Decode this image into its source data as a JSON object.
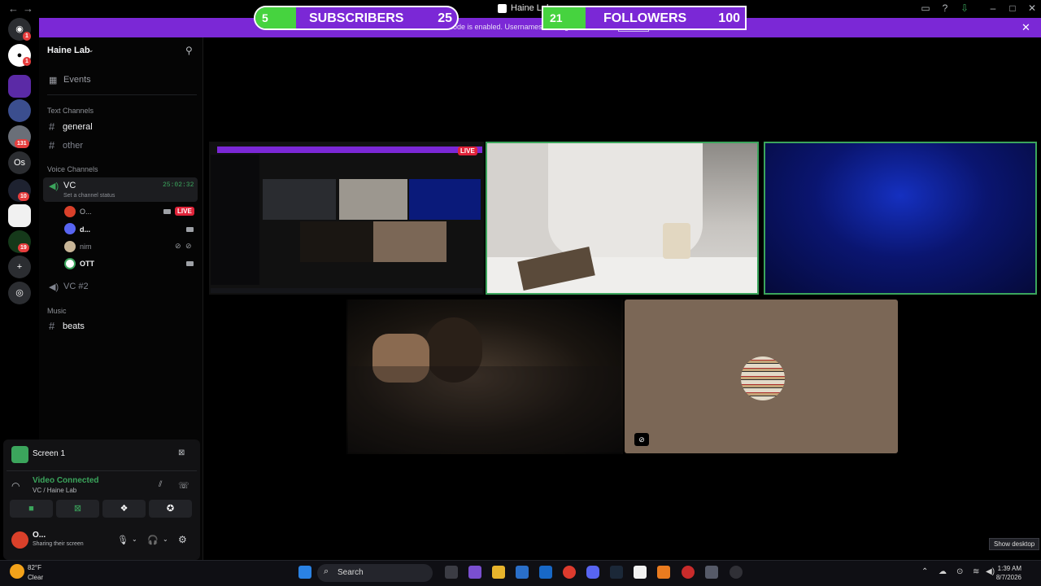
{
  "title_bar": {
    "title": "Haine Lab",
    "back": "←",
    "forward": "→"
  },
  "banner": {
    "text": "Streamer Mode is enabled. Usernames and tags are truncated.",
    "disable_label": "Disable",
    "close": "✕"
  },
  "overlay": {
    "subscribers": {
      "label": "SUBSCRIBERS",
      "current": "5",
      "goal": "25",
      "progress": 0.2
    },
    "followers": {
      "label": "FOLLOWERS",
      "current": "21",
      "goal": "100",
      "progress": 0.21
    }
  },
  "rail": {
    "badges": [
      "1",
      "1",
      "131",
      "10",
      "19"
    ],
    "os_label": "Os",
    "add": "+"
  },
  "server": {
    "name": "Haine Lab",
    "events_label": "Events",
    "text_category": "Text Channels",
    "text_channels": [
      "general",
      "other"
    ],
    "voice_category": "Voice Channels",
    "vc_name": "VC",
    "vc_timer": "25:02:32",
    "vc_status": "Set a channel status",
    "vc_users": [
      {
        "name": "O...",
        "live": "LIVE",
        "color": "#d9402a"
      },
      {
        "name": "d...",
        "color": "#5865f2"
      },
      {
        "name": "nim",
        "color": "#c8b597"
      },
      {
        "name": "OTT",
        "color": "#ffffff"
      }
    ],
    "vc2_name": "VC #2",
    "music_category": "Music",
    "music_channels": [
      "beats"
    ]
  },
  "panel": {
    "screen_label": "Screen 1",
    "connection_status": "Video Connected",
    "connection_path": "VC / Haine Lab",
    "user_name": "O...",
    "user_status": "Sharing their screen"
  },
  "stream": {
    "live_badge": "LIVE"
  },
  "taskbar": {
    "weather_temp": "82°F",
    "weather_desc": "Clear",
    "search_label": "Search",
    "time": "1:39 AM",
    "date": "8/7/2026",
    "show_desktop": "Show desktop"
  },
  "colors": {
    "accent_purple": "#7b28d6",
    "progress_green": "#46d33f",
    "speaking_green": "#3ba55c",
    "live_red": "#e0243a"
  }
}
